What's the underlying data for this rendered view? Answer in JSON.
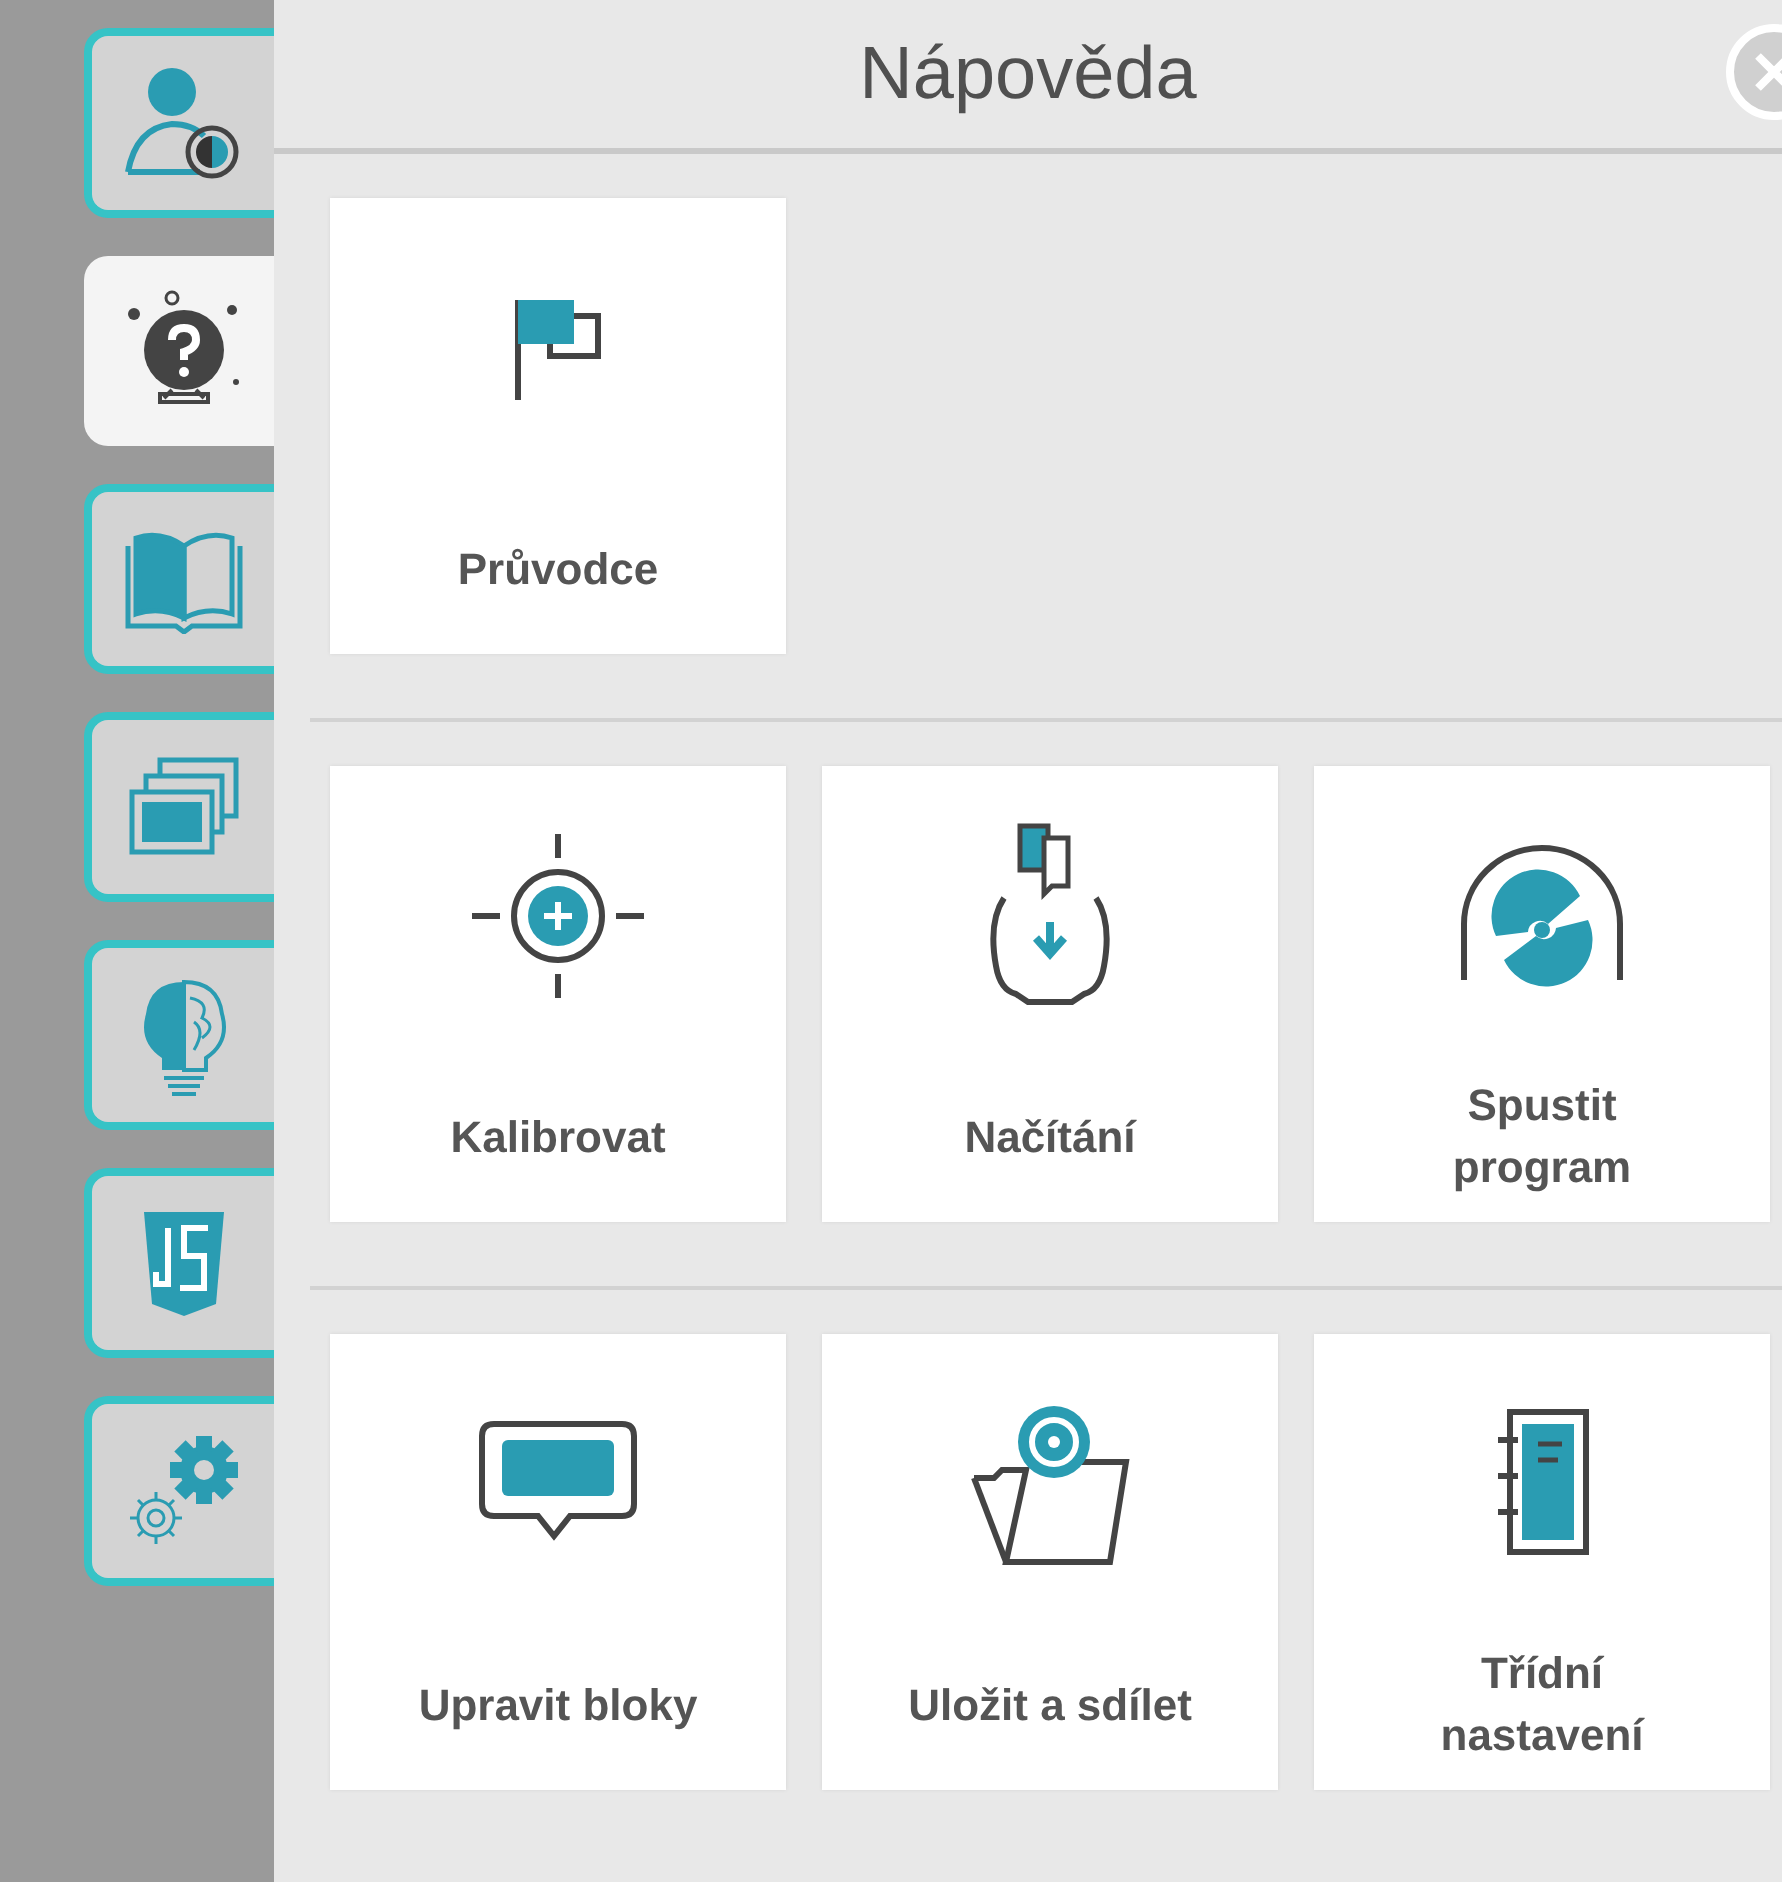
{
  "sidebar": {
    "tabs": [
      {
        "selected": false
      },
      {
        "selected": true
      },
      {
        "selected": false
      },
      {
        "selected": false
      },
      {
        "selected": false
      },
      {
        "selected": false
      },
      {
        "selected": false
      }
    ]
  },
  "panel": {
    "title": "Nápověda",
    "sections": [
      {
        "tiles": [
          {
            "label": "Průvodce"
          }
        ]
      },
      {
        "tiles": [
          {
            "label": "Kalibrovat"
          },
          {
            "label": "Načítání"
          },
          {
            "label": "Spustit program"
          }
        ]
      },
      {
        "tiles": [
          {
            "label": "Upravit bloky"
          },
          {
            "label": "Uložit a sdílet"
          },
          {
            "label": "Třídní nastavení"
          }
        ]
      }
    ]
  }
}
